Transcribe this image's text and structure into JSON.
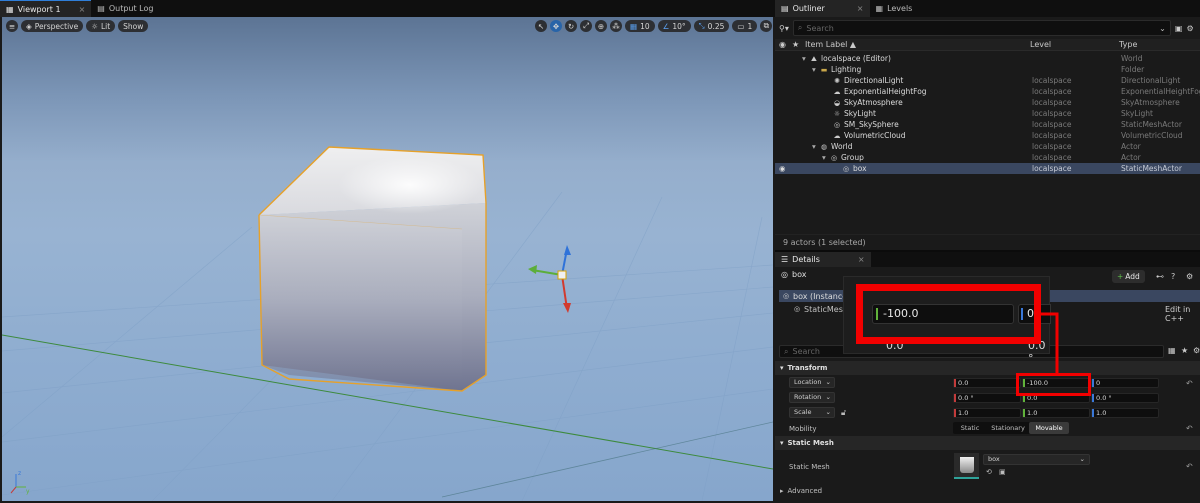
{
  "left_tabs": [
    {
      "label": "Viewport 1",
      "close": "×"
    },
    {
      "label": "Output Log"
    }
  ],
  "viewport": {
    "perspective": "Perspective",
    "lit": "Lit",
    "show": "Show",
    "grid_value": "10",
    "angle_value": "10°",
    "scale_value": "0.25",
    "camera_speed": "1"
  },
  "right_tabs": [
    {
      "label": "Outliner",
      "close": "×"
    },
    {
      "label": "Levels"
    }
  ],
  "outliner": {
    "search_placeholder": "Search",
    "columns": [
      "Item Label ▲",
      "Level",
      "Type"
    ],
    "rows": [
      {
        "label": "localspace (Editor)",
        "level": "",
        "type": "World",
        "indent": 27,
        "icon": "world-icon",
        "arrow": "▾"
      },
      {
        "label": "Lighting",
        "level": "",
        "type": "Folder",
        "indent": 37,
        "icon": "folder-icon",
        "arrow": "▾"
      },
      {
        "label": "DirectionalLight",
        "level": "localspace",
        "type": "DirectionalLight",
        "indent": 50,
        "icon": "sun-icon",
        "arrow": ""
      },
      {
        "label": "ExponentialHeightFog",
        "level": "localspace",
        "type": "ExponentialHeightFog",
        "indent": 50,
        "icon": "fog-icon",
        "arrow": ""
      },
      {
        "label": "SkyAtmosphere",
        "level": "localspace",
        "type": "SkyAtmosphere",
        "indent": 50,
        "icon": "atmosphere-icon",
        "arrow": ""
      },
      {
        "label": "SkyLight",
        "level": "localspace",
        "type": "SkyLight",
        "indent": 50,
        "icon": "skylight-icon",
        "arrow": ""
      },
      {
        "label": "SM_SkySphere",
        "level": "localspace",
        "type": "StaticMeshActor",
        "indent": 50,
        "icon": "mesh-icon",
        "arrow": ""
      },
      {
        "label": "VolumetricCloud",
        "level": "localspace",
        "type": "VolumetricCloud",
        "indent": 50,
        "icon": "cloud-icon",
        "arrow": ""
      },
      {
        "label": "World",
        "level": "localspace",
        "type": "Actor",
        "indent": 37,
        "icon": "globe-icon",
        "arrow": "▾"
      },
      {
        "label": "Group",
        "level": "localspace",
        "type": "Actor",
        "indent": 47,
        "icon": "group-icon",
        "arrow": "▾"
      },
      {
        "label": "box",
        "level": "localspace",
        "type": "StaticMeshActor",
        "indent": 59,
        "icon": "mesh-icon",
        "arrow": ""
      }
    ],
    "footer": "9 actors (1 selected)"
  },
  "details": {
    "tab": "Details",
    "close": "×",
    "object_name": "box",
    "add_label": "Add",
    "instance": "box (Instance)",
    "component": "StaticMesh",
    "edit_link": "Edit in C++",
    "search_placeholder": "Search",
    "transform_section": "Transform",
    "location_label": "Location",
    "location": [
      "0.0",
      "-100.0",
      "0"
    ],
    "rotation_label": "Rotation",
    "rotation": [
      "0.0 °",
      "0.0",
      "0.0 °"
    ],
    "scale_label": "Scale",
    "scale": [
      "1.0",
      "1.0",
      "1.0"
    ],
    "mobility_label": "Mobility",
    "mobility_options": [
      "Static",
      "Stationary",
      "Movable"
    ],
    "mobility_selected": "Movable",
    "static_mesh_section": "Static Mesh",
    "static_mesh_label": "Static Mesh",
    "static_mesh_value": "box",
    "advanced": "Advanced"
  },
  "zoom": {
    "value": "-100.0",
    "next_value": "0",
    "below_left": "0.0",
    "below_right": "0.0 °"
  },
  "colors": {
    "accent": "#2f7ed8",
    "selection": "#3a4760",
    "highlight": "#f20000",
    "x_axis": "#c23b3b",
    "y_axis": "#61b33b",
    "z_axis": "#3a78d8"
  }
}
